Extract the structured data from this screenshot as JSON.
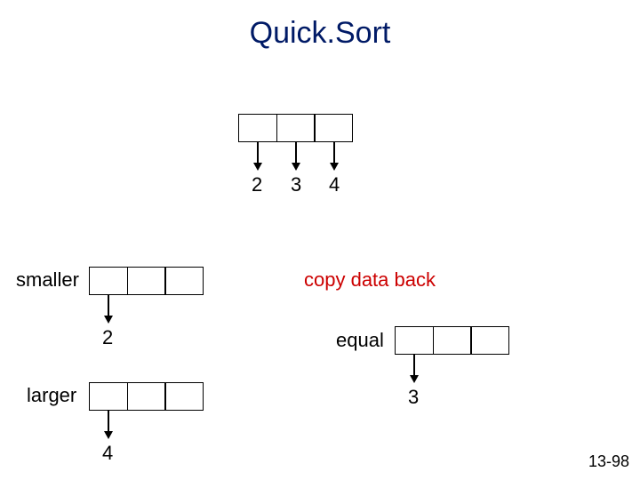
{
  "title": "Quick.Sort",
  "top": {
    "n1": "2",
    "n2": "3",
    "n3": "4"
  },
  "labels": {
    "smaller": "smaller",
    "larger": "larger",
    "equal": "equal"
  },
  "copy": "copy data back",
  "smaller_num": "2",
  "larger_num": "4",
  "equal_num": "3",
  "page": "13-98",
  "chart_data": {
    "type": "table",
    "title": "Quick.Sort",
    "description": "QuickSort partition illustration: three-cell array at top splits into smaller / equal / larger partitions, then 'copy data back'.",
    "top_array_values": [
      2,
      3,
      4
    ],
    "partitions": {
      "smaller": {
        "cells": 3,
        "value_below": 2
      },
      "equal": {
        "cells": 3,
        "value_below": 3
      },
      "larger": {
        "cells": 3,
        "value_below": 4
      }
    },
    "annotation": "copy data back"
  }
}
